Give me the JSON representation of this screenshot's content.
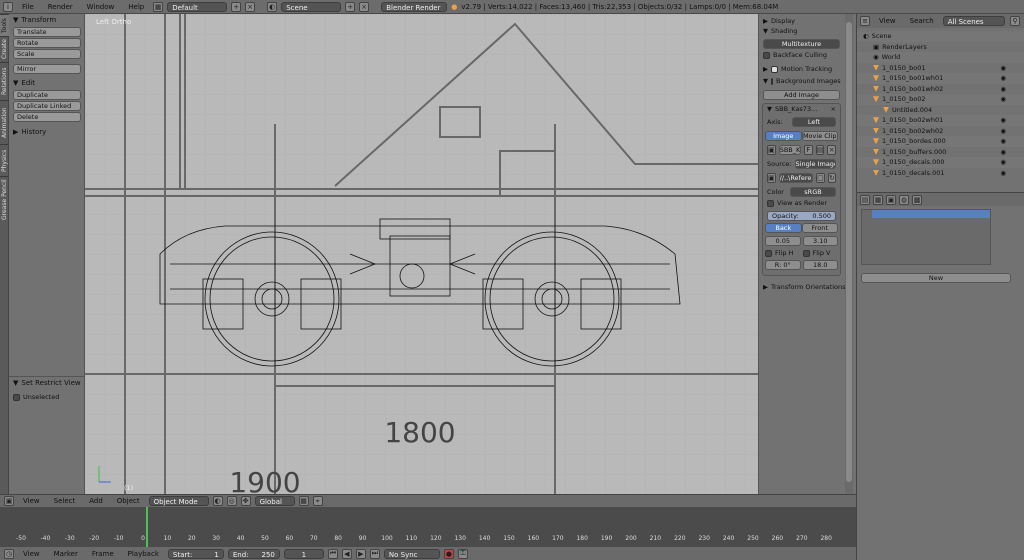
{
  "topbar": {
    "menus": [
      "File",
      "Render",
      "Window",
      "Help"
    ],
    "screen_layout": "Default",
    "scene": "Scene",
    "render_engine": "Blender Render",
    "stats": "v2.79 | Verts:14,022 | Faces:13,460 | Tris:22,353 | Objects:0/32 | Lamps:0/0 | Mem:68.04M"
  },
  "tool_tabs": [
    "Tools",
    "Create",
    "Relations",
    "Animation",
    "Physics",
    "Grease Pencil"
  ],
  "toolshelf": {
    "transform_header": "Transform",
    "transform_buttons": [
      "Translate",
      "Rotate",
      "Scale"
    ],
    "mirror": "Mirror",
    "edit_header": "Edit",
    "edit_buttons": [
      "Duplicate",
      "Duplicate Linked",
      "Delete"
    ],
    "history_header": "History",
    "restrict_header": "Set Restrict View",
    "unselected": "Unselected"
  },
  "viewport": {
    "view_label": "Left Ortho",
    "frame_marker": "(1)",
    "dimension_1": "1800",
    "dimension_2": "1900"
  },
  "npanel": {
    "display": "Display",
    "shading": "Shading",
    "shading_mode": "Multitexture",
    "backface": "Backface Culling",
    "motion_tracking": "Motion Tracking",
    "background_images": "Background Images",
    "add_image": "Add Image",
    "image_name": "SBB_Kas73...",
    "axis_label": "Axis:",
    "axis_value": "Left",
    "tab_image": "Image",
    "tab_movie": "Movie Clip",
    "sbb_field": "SBB_K",
    "f_label": "F",
    "source_label": "Source:",
    "source_value": "Single Image",
    "path": "//..\\Referen...",
    "color_label": "Color",
    "color_value": "sRGB",
    "view_as_render": "View as Render",
    "opacity_label": "Opacity:",
    "opacity_value": "0.500",
    "back": "Back",
    "front": "Front",
    "offset_x": "0.05",
    "offset_y": "3.10",
    "flip_h": "Flip H",
    "flip_v": "Flip V",
    "rotation": "R: 0°",
    "size": "18.0",
    "transform_orientations": "Transform Orientations"
  },
  "outliner": {
    "view": "View",
    "search": "Search",
    "filter": "All Scenes",
    "items": [
      "Scene",
      "RenderLayers",
      "World",
      "1_0150_bo01",
      "1_0150_bo01wh01",
      "1_0150_bo01wh02",
      "1_0150_bo02",
      "Untitled.004",
      "1_0150_bo02wh01",
      "1_0150_bo02wh02",
      "1_0150_bordes.000",
      "1_0150_buffers.000",
      "1_0150_decals.000",
      "1_0150_decals.001"
    ]
  },
  "image_panel": {
    "new_button": "New"
  },
  "viewport_header": {
    "menus": [
      "View",
      "Select",
      "Add",
      "Object"
    ],
    "mode": "Object Mode",
    "orientation": "Global"
  },
  "timeline": {
    "ticks": [
      "-50",
      "-40",
      "-30",
      "-20",
      "-10",
      "0",
      "10",
      "20",
      "30",
      "40",
      "50",
      "60",
      "70",
      "80",
      "90",
      "100",
      "110",
      "120",
      "130",
      "140",
      "150",
      "160",
      "170",
      "180",
      "190",
      "200",
      "210",
      "220",
      "230",
      "240",
      "250",
      "260",
      "270",
      "280"
    ],
    "menus": [
      "View",
      "Marker",
      "Frame",
      "Playback"
    ],
    "start_label": "Start:",
    "start_value": "1",
    "end_label": "End:",
    "end_value": "250",
    "current": "1",
    "sync": "No Sync"
  },
  "colors": {
    "accent": "#5680c2",
    "frame_cursor": "#4fc04f"
  }
}
